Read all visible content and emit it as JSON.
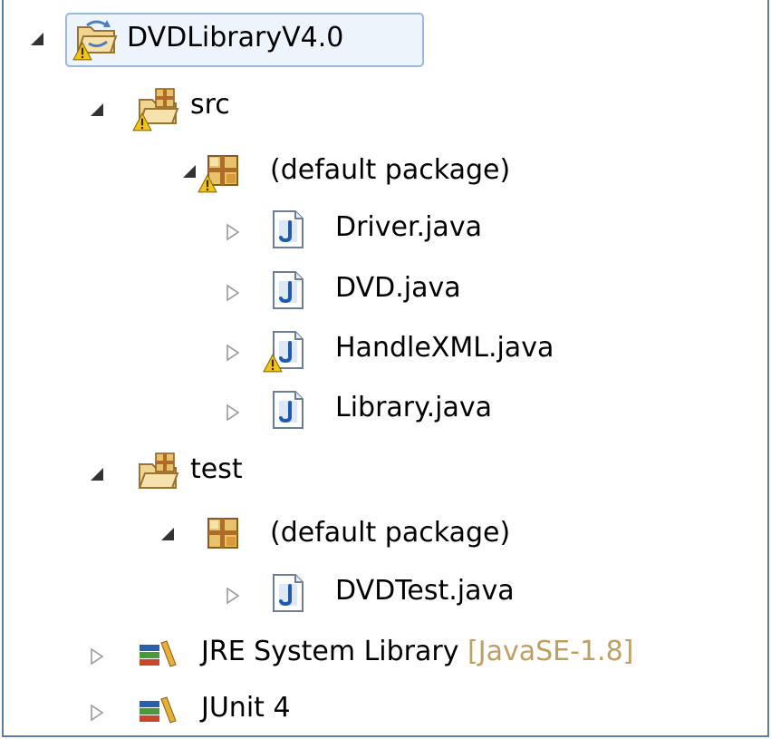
{
  "tree": {
    "project": {
      "label": "DVDLibraryV4.0"
    },
    "src_folder": {
      "label": "src"
    },
    "src_package": {
      "label": "(default package)"
    },
    "files_src": [
      {
        "label": "Driver.java"
      },
      {
        "label": "DVD.java"
      },
      {
        "label": "HandleXML.java"
      },
      {
        "label": "Library.java"
      }
    ],
    "test_folder": {
      "label": "test"
    },
    "test_package": {
      "label": "(default package)"
    },
    "files_test": [
      {
        "label": "DVDTest.java"
      }
    ],
    "jre": {
      "label": "JRE System Library",
      "decoration": "[JavaSE-1.8]"
    },
    "junit": {
      "label": "JUnit 4"
    }
  },
  "icons": {
    "expanded": "triangle-down-right",
    "collapsed": "triangle-right-outline",
    "warning": "warning-badge",
    "project": "java-project-icon",
    "source_folder": "source-folder-icon",
    "package": "package-icon",
    "java_file": "java-file-icon",
    "library": "library-icon"
  },
  "colors": {
    "selection_border": "#9ab8dc",
    "decoration_text": "#c0a060",
    "frame_border": "#5a7ea6"
  }
}
